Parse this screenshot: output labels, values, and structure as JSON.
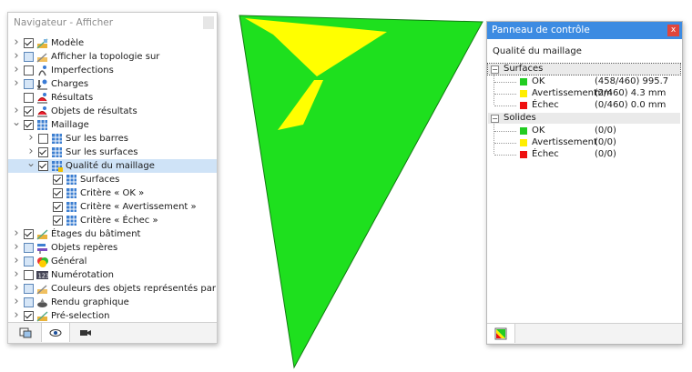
{
  "navigator": {
    "title": "Navigateur - Afficher",
    "items": [
      {
        "label": "Modèle",
        "check": "on",
        "arrow": ">",
        "level": 0,
        "icon": "model-icon"
      },
      {
        "label": "Afficher la topologie sur",
        "check": "part",
        "arrow": ">",
        "level": 0,
        "icon": "topology-icon"
      },
      {
        "label": "Imperfections",
        "check": "off",
        "arrow": ">",
        "level": 0,
        "icon": "imperfections-icon"
      },
      {
        "label": "Charges",
        "check": "part",
        "arrow": ">",
        "level": 0,
        "icon": "loads-icon"
      },
      {
        "label": "Résultats",
        "check": "off",
        "arrow": "",
        "level": 0,
        "icon": "results-icon"
      },
      {
        "label": "Objets de résultats",
        "check": "on",
        "arrow": ">",
        "level": 0,
        "icon": "result-objects-icon"
      },
      {
        "label": "Maillage",
        "check": "on",
        "arrow": "v",
        "level": 0,
        "icon": "mesh-icon"
      },
      {
        "label": "Sur les barres",
        "check": "off",
        "arrow": ">",
        "level": 1,
        "icon": "mesh-icon"
      },
      {
        "label": "Sur les surfaces",
        "check": "on",
        "arrow": ">",
        "level": 1,
        "icon": "mesh-icon"
      },
      {
        "label": "Qualité du maillage",
        "check": "on",
        "arrow": "v",
        "level": 1,
        "icon": "mesh-quality-icon",
        "selected": true
      },
      {
        "label": "Surfaces",
        "check": "on",
        "arrow": "",
        "level": 2,
        "icon": "mesh-icon"
      },
      {
        "label": "Critère « OK »",
        "check": "on",
        "arrow": "",
        "level": 2,
        "icon": "mesh-icon"
      },
      {
        "label": "Critère « Avertissement »",
        "check": "on",
        "arrow": "",
        "level": 2,
        "icon": "mesh-icon"
      },
      {
        "label": "Critère « Échec »",
        "check": "on",
        "arrow": "",
        "level": 2,
        "icon": "mesh-icon"
      },
      {
        "label": "Étages du bâtiment",
        "check": "on",
        "arrow": ">",
        "level": 0,
        "icon": "building-stories-icon"
      },
      {
        "label": "Objets repères",
        "check": "part",
        "arrow": ">",
        "level": 0,
        "icon": "guide-objects-icon"
      },
      {
        "label": "Général",
        "check": "part",
        "arrow": ">",
        "level": 0,
        "icon": "general-icon"
      },
      {
        "label": "Numérotation",
        "check": "off",
        "arrow": ">",
        "level": 0,
        "icon": "numbering-icon"
      },
      {
        "label": "Couleurs des objets représentés par",
        "check": "part",
        "arrow": ">",
        "level": 0,
        "icon": "colors-icon"
      },
      {
        "label": "Rendu graphique",
        "check": "part",
        "arrow": ">",
        "level": 0,
        "icon": "rendering-icon"
      },
      {
        "label": "Pré-selection",
        "check": "on",
        "arrow": ">",
        "level": 0,
        "icon": "preselection-icon"
      }
    ],
    "tabs": [
      {
        "icon": "data-tab-icon"
      },
      {
        "icon": "view-tab-icon"
      },
      {
        "icon": "camera-tab-icon"
      }
    ]
  },
  "control_panel": {
    "title": "Panneau de contrôle",
    "close_label": "x",
    "subtitle": "Qualité du maillage",
    "groups": [
      {
        "label": "Surfaces",
        "items": [
          {
            "label": "OK",
            "value": "(458/460) 995.7 mm",
            "color": "#22cc22"
          },
          {
            "label": "Avertissement",
            "value": "(2/460) 4.3 mm",
            "color": "#ffee00"
          },
          {
            "label": "Échec",
            "value": "(0/460) 0.0 mm",
            "color": "#ee1111"
          }
        ]
      },
      {
        "label": "Solides",
        "items": [
          {
            "label": "OK",
            "value": "(0/0)",
            "color": "#22cc22"
          },
          {
            "label": "Avertissement",
            "value": "(0/0)",
            "color": "#ffee00"
          },
          {
            "label": "Échec",
            "value": "(0/0)",
            "color": "#ee1111"
          }
        ]
      }
    ]
  },
  "colors": {
    "ok": "#1ee01e",
    "warning": "#ffff00",
    "accent": "#3c8be2",
    "selection": "#cfe3f7"
  }
}
